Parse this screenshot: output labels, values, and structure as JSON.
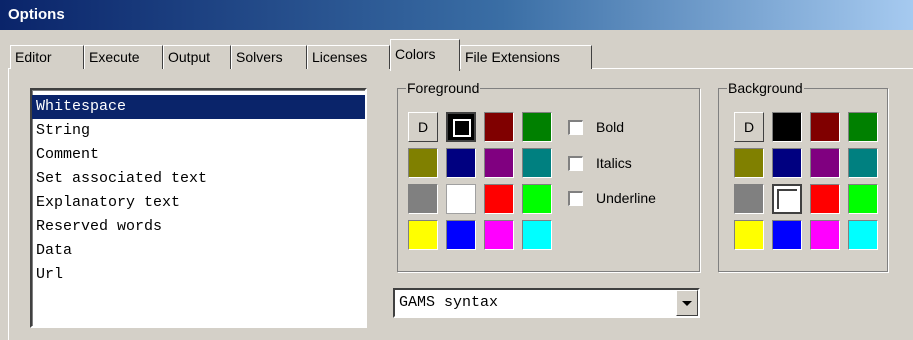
{
  "window": {
    "title": "Options"
  },
  "tabs": [
    {
      "label": "Editor"
    },
    {
      "label": "Execute"
    },
    {
      "label": "Output"
    },
    {
      "label": "Solvers"
    },
    {
      "label": "Licenses"
    },
    {
      "label": "Colors",
      "active": true
    },
    {
      "label": "File Extensions"
    }
  ],
  "element_list": {
    "items": [
      "Whitespace",
      "String",
      "Comment",
      "Set associated text",
      "Explanatory text",
      "Reserved words",
      "Data",
      "Url"
    ],
    "selected": "Whitespace"
  },
  "foreground": {
    "legend": "Foreground",
    "default_label": "D",
    "selected_color": "#000000",
    "colors": [
      "#000000",
      "#800000",
      "#008000",
      "#808000",
      "#000080",
      "#800080",
      "#008080",
      "#808080",
      "#ffffff",
      "#ff0000",
      "#00ff00",
      "#ffff00",
      "#0000ff",
      "#ff00ff",
      "#00ffff"
    ]
  },
  "style_options": {
    "bold": {
      "label": "Bold",
      "checked": false
    },
    "italics": {
      "label": "Italics",
      "checked": false
    },
    "underline": {
      "label": "Underline",
      "checked": false
    }
  },
  "background": {
    "legend": "Background",
    "default_label": "D",
    "selected_color": "#ffffff",
    "colors": [
      "#000000",
      "#800000",
      "#008000",
      "#808000",
      "#000080",
      "#800080",
      "#008080",
      "#808080",
      "#ffffff",
      "#ff0000",
      "#00ff00",
      "#ffff00",
      "#0000ff",
      "#ff00ff",
      "#00ffff"
    ]
  },
  "syntax_select": {
    "value": "GAMS syntax"
  }
}
